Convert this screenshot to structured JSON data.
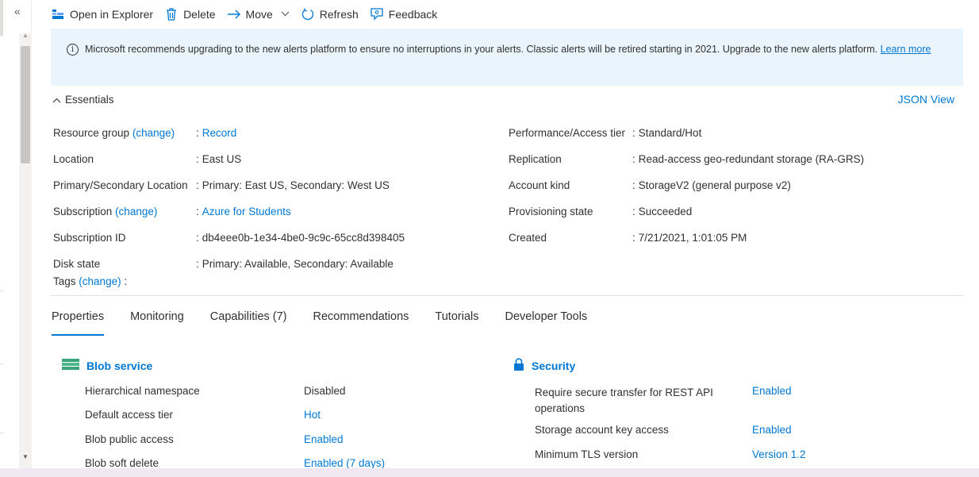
{
  "nav": {
    "collapse_glyph": "«"
  },
  "toolbar": {
    "items": [
      {
        "label": "Open in Explorer",
        "icon": "storage-explorer-icon"
      },
      {
        "label": "Delete",
        "icon": "trash-icon"
      },
      {
        "label": "Move",
        "icon": "arrow-right-icon",
        "has_dropdown": true
      },
      {
        "label": "Refresh",
        "icon": "refresh-icon"
      },
      {
        "label": "Feedback",
        "icon": "feedback-icon"
      }
    ]
  },
  "banner": {
    "text": "Microsoft recommends upgrading to the new alerts platform to ensure no interruptions in your alerts. Classic alerts will be retired starting in 2021. Upgrade to the new alerts platform.",
    "link": "Learn more"
  },
  "essentials": {
    "title": "Essentials",
    "json_view": "JSON View",
    "change_link": "(change)",
    "left": [
      {
        "label": "Resource group",
        "change": true,
        "value": "Record",
        "is_link": true
      },
      {
        "label": "Location",
        "value": "East US"
      },
      {
        "label": "Primary/Secondary Location",
        "value": "Primary: East US, Secondary: West US"
      },
      {
        "label": "Subscription",
        "change": true,
        "value": "Azure for Students",
        "is_link": true
      },
      {
        "label": "Subscription ID",
        "value": "db4eee0b-1e34-4be0-9c9c-65cc8d398405"
      },
      {
        "label": "Disk state",
        "value": "Primary: Available, Secondary: Available"
      }
    ],
    "right": [
      {
        "label": "Performance/Access tier",
        "value": "Standard/Hot"
      },
      {
        "label": "Replication",
        "value": "Read-access geo-redundant storage (RA-GRS)"
      },
      {
        "label": "Account kind",
        "value": "StorageV2 (general purpose v2)"
      },
      {
        "label": "Provisioning state",
        "value": "Succeeded"
      },
      {
        "label": "Created",
        "value": "7/21/2021, 1:01:05 PM"
      }
    ],
    "tags_label": "Tags",
    "tags_change": "(change)",
    "tags_sep": ":"
  },
  "tabs": [
    {
      "label": "Properties",
      "active": true
    },
    {
      "label": "Monitoring"
    },
    {
      "label": "Capabilities (7)"
    },
    {
      "label": "Recommendations"
    },
    {
      "label": "Tutorials"
    },
    {
      "label": "Developer Tools"
    }
  ],
  "properties": {
    "blob": {
      "title": "Blob service",
      "rows": [
        {
          "label": "Hierarchical namespace",
          "value": "Disabled",
          "is_link": false
        },
        {
          "label": "Default access tier",
          "value": "Hot",
          "is_link": true
        },
        {
          "label": "Blob public access",
          "value": "Enabled",
          "is_link": true
        },
        {
          "label": "Blob soft delete",
          "value": "Enabled (7 days)",
          "is_link": true
        }
      ]
    },
    "security": {
      "title": "Security",
      "rows": [
        {
          "label": "Require secure transfer for REST API operations",
          "value": "Enabled",
          "is_link": true
        },
        {
          "label": "Storage account key access",
          "value": "Enabled",
          "is_link": true
        },
        {
          "label": "Minimum TLS version",
          "value": "Version 1.2",
          "is_link": true
        }
      ]
    }
  },
  "colors": {
    "accent": "#0078d4",
    "banner_bg": "#eaf4fc",
    "text": "#323130"
  }
}
